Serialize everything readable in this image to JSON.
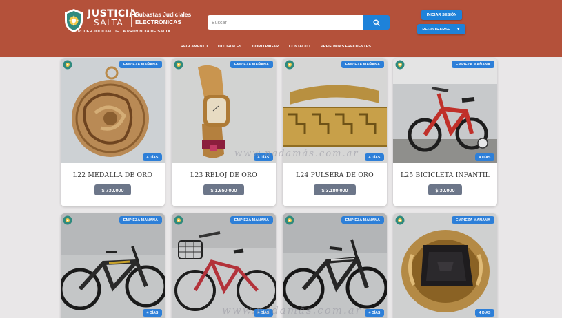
{
  "brand": {
    "name_line1": "JUSTICIA",
    "name_line2": "SALTA",
    "sub_line1": "Subastas Judiciales",
    "sub_line2": "ELECTRÓNICAS",
    "org": "PODER JUDICIAL DE LA PROVINCIA DE SALTA"
  },
  "search": {
    "placeholder": "Buscar",
    "icon": "search-icon"
  },
  "account": {
    "login_label": "INICIAR SESIÓN",
    "register_label": "REGISTRARSE",
    "register_caret": "▼"
  },
  "nav": [
    "REGLAMENTO",
    "TUTORIALES",
    "COMO PAGAR",
    "CONTACTO",
    "PREGUNTAS FRECUENTES"
  ],
  "colors": {
    "header": "#b4513a",
    "accent": "#1e82d9",
    "badge": "#2d7fd8",
    "price": "#6c7689",
    "page_bg": "#e9e7e8"
  },
  "watermark": [
    "www.nadamás.com.ar",
    "www.nadamás.com.ar"
  ],
  "lots": [
    {
      "title": "L22 MEDALLA DE ORO",
      "price": "$ 730.000",
      "badge": "EMPIEZA MAÑANA",
      "days": "4 DÍAS",
      "photo": "gold-medal"
    },
    {
      "title": "L23 RELOJ DE ORO",
      "price": "$ 1.650.000",
      "badge": "EMPIEZA MAÑANA",
      "days": "4 DÍAS",
      "photo": "gold-watch"
    },
    {
      "title": "L24 PULSERA DE ORO",
      "price": "$ 3.180.000",
      "badge": "EMPIEZA MAÑANA",
      "days": "4 DÍAS",
      "photo": "gold-bracelet"
    },
    {
      "title": "L25 BICICLETA INFANTIL",
      "price": "$ 30.000",
      "badge": "EMPIEZA MAÑANA",
      "days": "4 DÍAS",
      "photo": "kids-bicycle"
    },
    {
      "title": "",
      "price": "",
      "badge": "EMPIEZA MAÑANA",
      "days": "4 DÍAS",
      "photo": "black-mountain-bike"
    },
    {
      "title": "",
      "price": "",
      "badge": "EMPIEZA MAÑANA",
      "days": "4 DÍAS",
      "photo": "red-city-bike"
    },
    {
      "title": "",
      "price": "",
      "badge": "EMPIEZA MAÑANA",
      "days": "4 DÍAS",
      "photo": "black-mountain-bike-2"
    },
    {
      "title": "",
      "price": "",
      "badge": "EMPIEZA MAÑANA",
      "days": "4 DÍAS",
      "photo": "gold-signet-ring"
    }
  ]
}
